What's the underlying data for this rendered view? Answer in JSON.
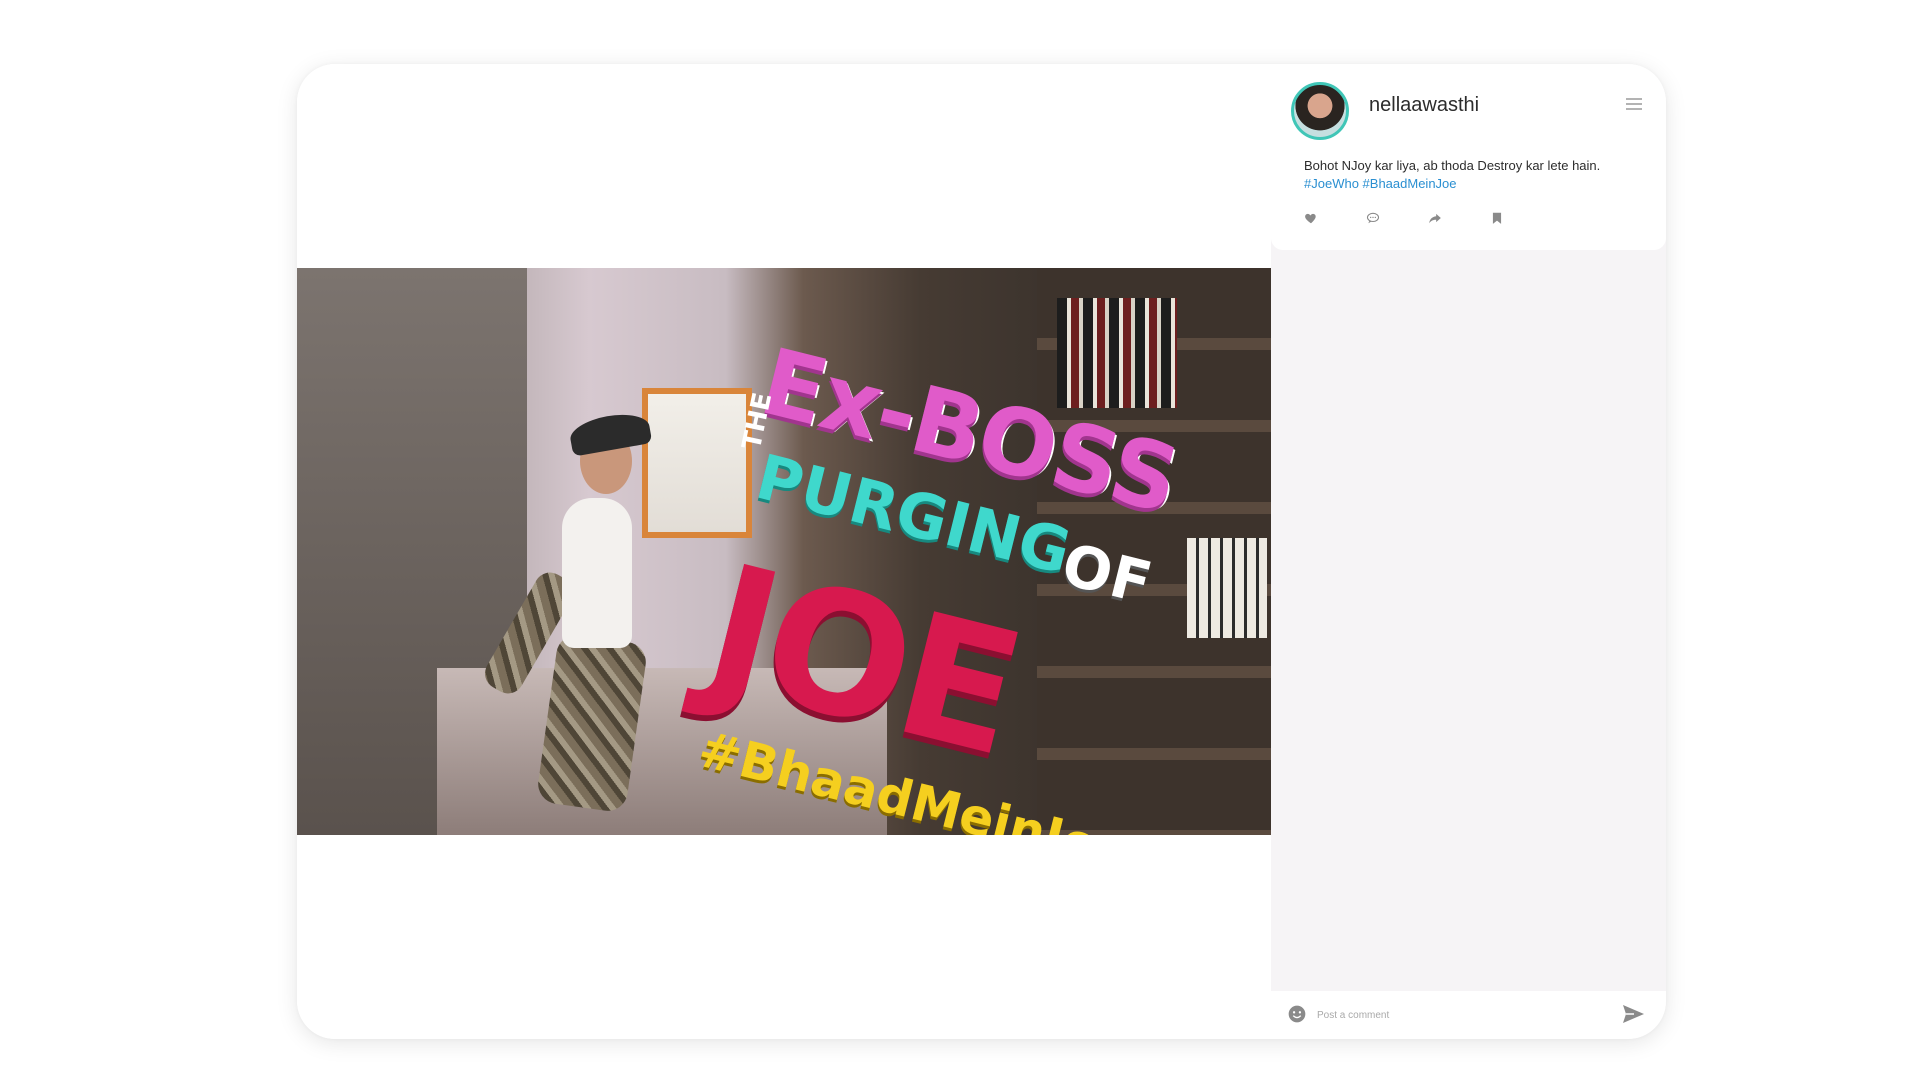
{
  "post": {
    "username": "nellaawasthi",
    "caption": "Bohot NJoy kar liya, ab thoda Destroy kar lete hain.",
    "hashtags": [
      "#JoeWho",
      "#BhaadMeinJoe"
    ]
  },
  "image": {
    "title_line1": "Ex-BOSS",
    "title_the": "THE",
    "title_line2": "PURGING",
    "title_of": "OF",
    "title_line3": "JOE",
    "title_hashtag": "#BhaadMeinJoe"
  },
  "actions": {
    "like_icon": "heart-icon",
    "comment_icon": "comment-bubble-icon",
    "share_icon": "share-arrow-icon",
    "save_icon": "bookmark-icon"
  },
  "comment": {
    "placeholder": "Post a comment"
  },
  "colors": {
    "accent": "#2a8fd1",
    "avatar_ring": "#40c6b7",
    "panel_bg": "#f6f4f6"
  }
}
